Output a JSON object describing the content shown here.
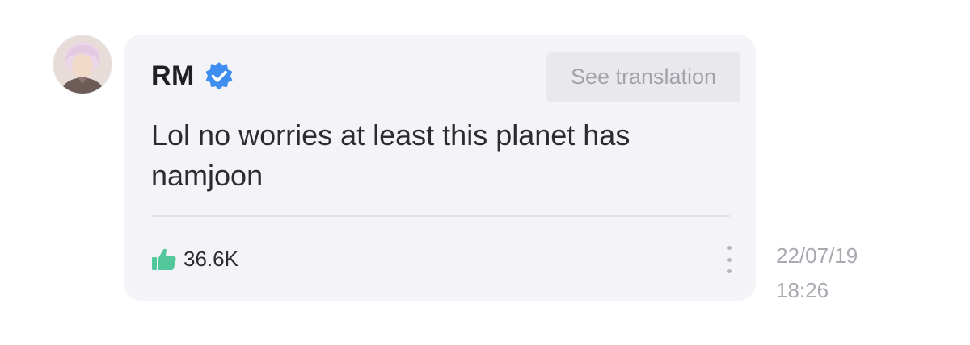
{
  "comment": {
    "author": {
      "name": "RM",
      "verified": true,
      "avatar_icon": "avatar-photo"
    },
    "translate_label": "See translation",
    "text": "Lol no worries at least this planet has namjoon",
    "likes": {
      "count": "36.6K",
      "icon": "thumbs-up-icon"
    },
    "more_icon": "vertical-ellipsis-icon",
    "date": "22/07/19",
    "time": "18:26"
  },
  "colors": {
    "card_bg": "#f4f4f8",
    "verified_blue": "#3d8ef0",
    "like_green": "#52c79b",
    "muted_text": "#a8a8b0"
  }
}
